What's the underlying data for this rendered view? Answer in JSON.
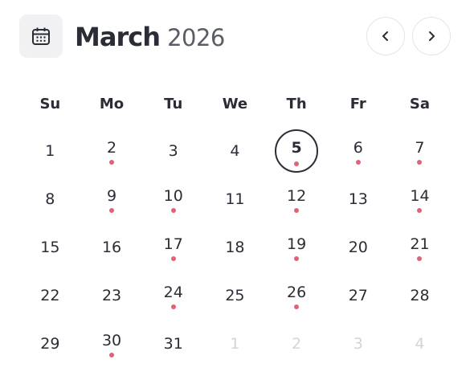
{
  "header": {
    "month": "March",
    "year": "2026",
    "icons": {
      "calendar": "calendar-icon",
      "prev": "chevron-left-icon",
      "next": "chevron-right-icon"
    }
  },
  "weekdays": [
    "Su",
    "Mo",
    "Tu",
    "We",
    "Th",
    "Fr",
    "Sa"
  ],
  "colors": {
    "text": "#2b2d36",
    "muted": "#d3d4d8",
    "event_dot": "#e26178",
    "icon_bg": "#f1f1f3",
    "border": "#e3e4e8"
  },
  "weeks": [
    [
      {
        "label": "1"
      },
      {
        "label": "2",
        "event": true
      },
      {
        "label": "3"
      },
      {
        "label": "4"
      },
      {
        "label": "5",
        "event": true,
        "selected": true
      },
      {
        "label": "6",
        "event": true
      },
      {
        "label": "7",
        "event": true
      }
    ],
    [
      {
        "label": "8"
      },
      {
        "label": "9",
        "event": true
      },
      {
        "label": "10",
        "event": true
      },
      {
        "label": "11"
      },
      {
        "label": "12",
        "event": true
      },
      {
        "label": "13"
      },
      {
        "label": "14",
        "event": true
      }
    ],
    [
      {
        "label": "15"
      },
      {
        "label": "16"
      },
      {
        "label": "17",
        "event": true
      },
      {
        "label": "18"
      },
      {
        "label": "19",
        "event": true
      },
      {
        "label": "20"
      },
      {
        "label": "21",
        "event": true
      }
    ],
    [
      {
        "label": "22"
      },
      {
        "label": "23"
      },
      {
        "label": "24",
        "event": true
      },
      {
        "label": "25"
      },
      {
        "label": "26",
        "event": true
      },
      {
        "label": "27"
      },
      {
        "label": "28"
      }
    ],
    [
      {
        "label": "29"
      },
      {
        "label": "30",
        "event": true
      },
      {
        "label": "31"
      },
      {
        "label": "1",
        "muted": true
      },
      {
        "label": "2",
        "muted": true
      },
      {
        "label": "3",
        "muted": true
      },
      {
        "label": "4",
        "muted": true
      }
    ]
  ]
}
